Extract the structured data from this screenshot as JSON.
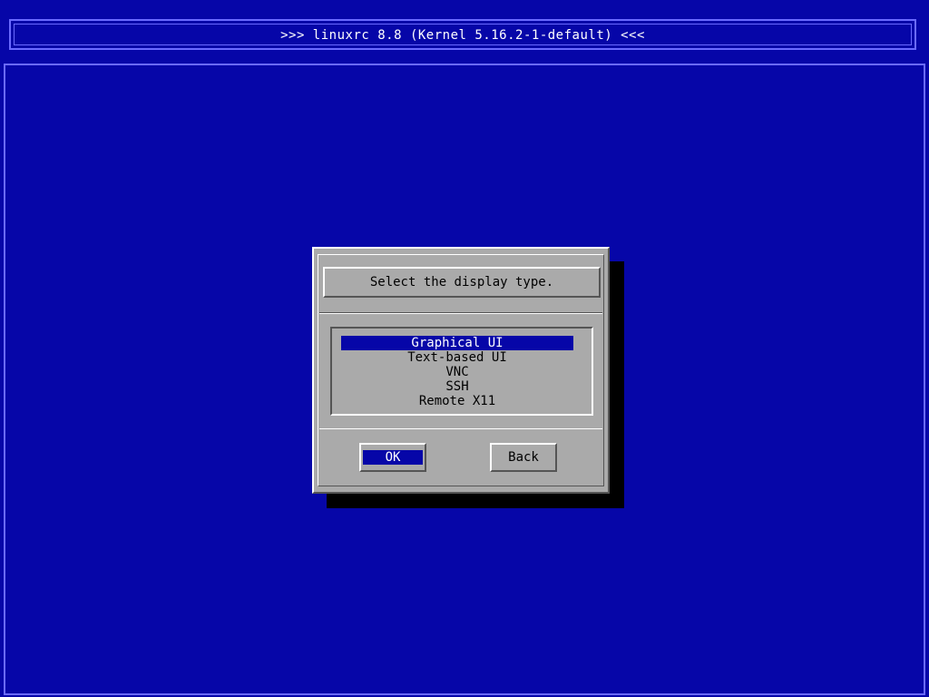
{
  "window": {
    "title": ">>> linuxrc 8.8 (Kernel 5.16.2-1-default) <<<"
  },
  "dialog": {
    "prompt": "Select the display type.",
    "options": [
      {
        "label": "Graphical UI",
        "selected": true
      },
      {
        "label": "Text-based UI",
        "selected": false
      },
      {
        "label": "VNC",
        "selected": false
      },
      {
        "label": "SSH",
        "selected": false
      },
      {
        "label": "Remote X11",
        "selected": false
      }
    ],
    "buttons": {
      "ok_label": "OK",
      "back_label": "Back"
    }
  },
  "colors": {
    "background": "#0606a8",
    "dialog": "#aaaaaa",
    "highlight": "#0606a8",
    "frame": "#6a6aff"
  }
}
